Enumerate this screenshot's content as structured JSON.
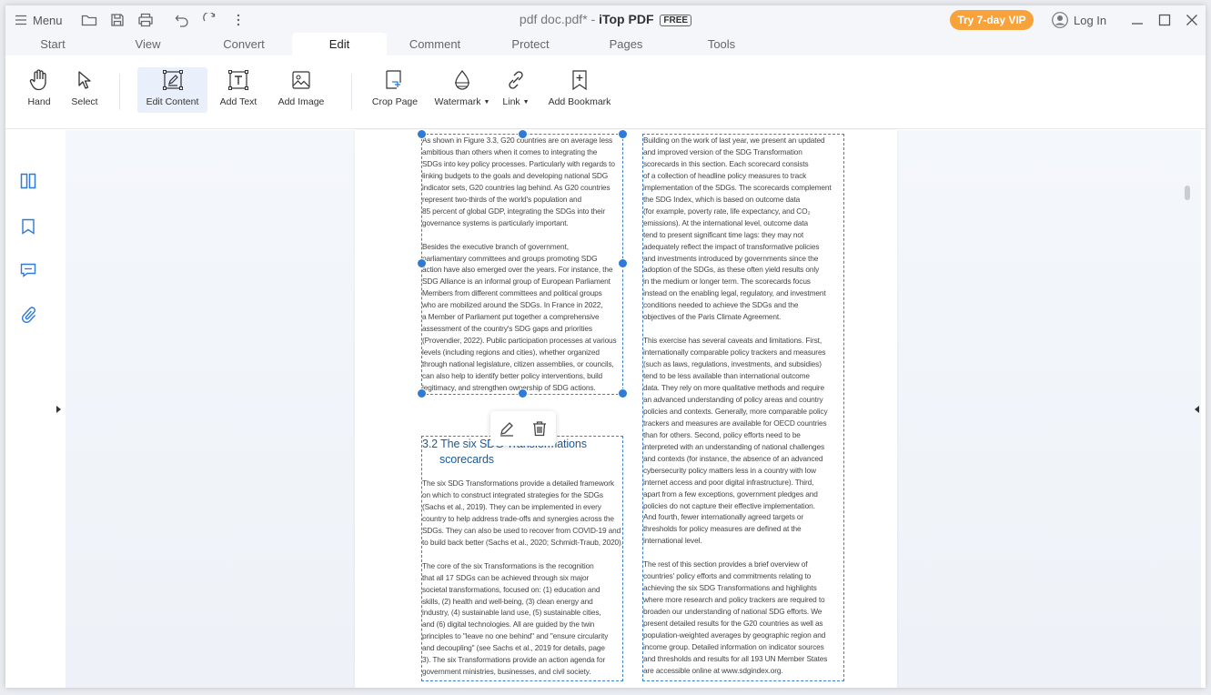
{
  "titlebar": {
    "menu_label": "Menu",
    "doc_name": "pdf doc.pdf* - ",
    "app_name": "iTop PDF",
    "free_badge": "FREE",
    "vip_label": "Try 7-day VIP",
    "login_label": "Log In"
  },
  "tabs": [
    "Start",
    "View",
    "Convert",
    "Edit",
    "Comment",
    "Protect",
    "Pages",
    "Tools"
  ],
  "active_tab": "Edit",
  "ribbon": {
    "hand": "Hand",
    "select": "Select",
    "edit_content": "Edit Content",
    "add_text": "Add Text",
    "add_image": "Add Image",
    "crop_page": "Crop Page",
    "watermark": "Watermark",
    "link": "Link",
    "add_bookmark": "Add Bookmark"
  },
  "accent_color": "#2e7ad6",
  "vip_color": "#f7a23b",
  "document": {
    "left_col_p1": [
      "As shown in Figure 3.3, G20 countries are on average less",
      "ambitious than others when it comes to integrating the",
      "SDGs into key policy processes. Particularly with regards to",
      "linking budgets to the goals and developing national SDG",
      "indicator sets, G20 countries lag behind. As G20 countries",
      "represent two-thirds of the world's population and",
      "85 percent of global GDP, integrating the SDGs into their",
      "governance systems is particularly important."
    ],
    "left_col_p2": [
      "Besides the executive branch of government,",
      "parliamentary committees and groups promoting SDG",
      "action have also emerged over the years. For instance, the",
      "SDG Alliance is an informal group of European Parliament",
      "Members from different committees and political groups",
      "who are mobilized around the SDGs. In France in 2022,",
      "a Member of Parliament put together a comprehensive",
      "assessment of the country's SDG gaps and priorities",
      "(Provendier, 2022). Public participation processes at various",
      "levels (including regions and cities), whether organized",
      "through national legislature, citizen assemblies, or councils,",
      "can also help to identify better policy interventions, build",
      "legitimacy, and strengthen ownership of SDG actions."
    ],
    "section_heading_line1": "3.2 The six SDG Transformations",
    "section_heading_line2": "scorecards",
    "left_col_p3": [
      "The six SDG Transformations provide a detailed framework",
      "on which to construct integrated strategies for the SDGs",
      "(Sachs et al., 2019). They can be implemented in every",
      "country to help address trade-offs and synergies across the",
      "SDGs. They can also be used to recover from COVID-19 and",
      "to build back better (Sachs et al., 2020; Schmidt-Traub, 2020)."
    ],
    "left_col_p4": [
      "The core of the six Transformations is the recognition",
      "that all 17 SDGs can be achieved through six major",
      "societal transformations, focused on: (1) education and",
      "skills, (2) health and well-being, (3) clean energy and",
      "industry, (4) sustainable land use, (5) sustainable cities,",
      "and (6) digital technologies. All are guided by the twin",
      "principles to \"leave no one behind\" and \"ensure circularity",
      "and decoupling\" (see Sachs et al., 2019 for details, page",
      "3). The six Transformations provide an action agenda for",
      "government ministries, businesses, and civil society."
    ],
    "right_col_p1": [
      "Building on the work of last year, we present an updated",
      "and improved version of the SDG Transformation",
      "scorecards in this section. Each scorecard consists",
      "of a collection of headline policy measures to track",
      "implementation of the SDGs. The scorecards complement",
      "the SDG Index, which is based on outcome data",
      "(for example, poverty rate, life expectancy, and CO₂",
      "emissions). At the international level, outcome data",
      "tend to present significant time lags: they may not",
      "adequately reflect the impact of transformative policies",
      "and investments introduced by governments since the",
      "adoption of the SDGs, as these often yield results only",
      "in the medium or longer term. The scorecards focus",
      "instead on the enabling legal, regulatory, and investment",
      "conditions needed to achieve the SDGs and the",
      "objectives of the Paris Climate Agreement."
    ],
    "right_col_p2": [
      "This exercise has several caveats and limitations. First,",
      "internationally comparable policy trackers and measures",
      "(such as laws, regulations, investments, and subsidies)",
      "tend to be less available than international outcome",
      "data. They rely on more qualitative methods and require",
      "an advanced understanding of policy areas and country",
      "policies and contexts. Generally, more comparable policy",
      "trackers and measures are available for OECD countries",
      "than for others. Second, policy efforts need to be",
      "interpreted with an understanding of national challenges",
      "and contexts (for instance, the absence of an advanced",
      "cybersecurity policy matters less in a country with low",
      "internet access and poor digital infrastructure). Third,",
      "apart from a few exceptions, government pledges and",
      "policies do not capture their effective implementation.",
      "And fourth, fewer internationally agreed targets or",
      "thresholds for policy measures are defined at the",
      "international level."
    ],
    "right_col_p3": [
      "The rest of this section provides a brief overview of",
      "countries' policy efforts and commitments relating to",
      "achieving the six SDG Transformations and highlights",
      "where more research and policy trackers are required to",
      "broaden our understanding of national SDG efforts. We",
      "present detailed results for the G20 countries as well as",
      "population-weighted averages by geographic region and",
      "income group. Detailed information on indicator sources",
      "and thresholds and results for all 193 UN Member States",
      "are accessible online at www.sdgindex.org."
    ]
  }
}
